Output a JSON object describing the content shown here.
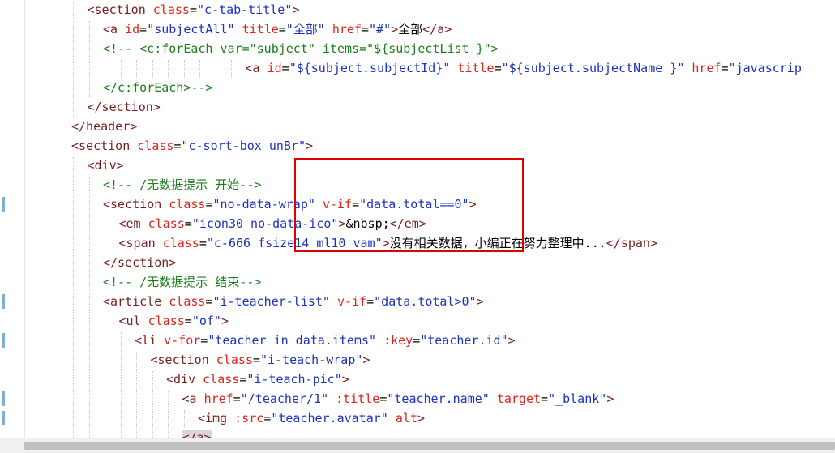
{
  "editor": {
    "lines": [
      {
        "indent": 5,
        "tokens": [
          [
            "tag",
            "<section"
          ],
          [
            "sp",
            " "
          ],
          [
            "attr",
            "class"
          ],
          [
            "eq",
            "="
          ],
          [
            "val",
            "\"c-tab-title\""
          ],
          [
            "tag",
            ">"
          ]
        ]
      },
      {
        "indent": 6,
        "tokens": [
          [
            "tag",
            "<a"
          ],
          [
            "sp",
            " "
          ],
          [
            "attr",
            "id"
          ],
          [
            "eq",
            "="
          ],
          [
            "val",
            "\"subjectAll\""
          ],
          [
            "sp",
            " "
          ],
          [
            "attr",
            "title"
          ],
          [
            "eq",
            "="
          ],
          [
            "val",
            "\"全部\""
          ],
          [
            "sp",
            " "
          ],
          [
            "attr",
            "href"
          ],
          [
            "eq",
            "="
          ],
          [
            "val",
            "\"#\""
          ],
          [
            "tag",
            ">"
          ],
          [
            "txt",
            "全部"
          ],
          [
            "tag",
            "</a>"
          ]
        ]
      },
      {
        "indent": 6,
        "tokens": [
          [
            "cmt",
            "<!-- <c:forEach var=\"subject\" items=\"${subjectList }\">"
          ]
        ]
      },
      {
        "indent": 15,
        "tokens": [
          [
            "tag",
            "<a"
          ],
          [
            "sp",
            " "
          ],
          [
            "attr",
            "id"
          ],
          [
            "eq",
            "="
          ],
          [
            "val",
            "\"${subject.subjectId}\""
          ],
          [
            "sp",
            " "
          ],
          [
            "attr",
            "title"
          ],
          [
            "eq",
            "="
          ],
          [
            "val",
            "\"${subject.subjectName }\""
          ],
          [
            "sp",
            " "
          ],
          [
            "attr",
            "href"
          ],
          [
            "eq",
            "="
          ],
          [
            "val",
            "\"javascrip"
          ]
        ]
      },
      {
        "indent": 6,
        "tokens": [
          [
            "cmt",
            "</c:forEach>-->"
          ]
        ]
      },
      {
        "indent": 5,
        "tokens": [
          [
            "tag",
            "</section>"
          ]
        ]
      },
      {
        "indent": 4,
        "tokens": [
          [
            "tag",
            "</header>"
          ]
        ]
      },
      {
        "indent": 4,
        "tokens": [
          [
            "tag",
            "<section"
          ],
          [
            "sp",
            " "
          ],
          [
            "attr",
            "class"
          ],
          [
            "eq",
            "="
          ],
          [
            "val",
            "\"c-sort-box unBr\""
          ],
          [
            "tag",
            ">"
          ]
        ]
      },
      {
        "indent": 5,
        "tokens": [
          [
            "tag",
            "<div>"
          ]
        ]
      },
      {
        "indent": 6,
        "tokens": [
          [
            "cmt",
            "<!-- /无数据提示 开始-->"
          ]
        ]
      },
      {
        "indent": 6,
        "tokens": [
          [
            "tag",
            "<section"
          ],
          [
            "sp",
            " "
          ],
          [
            "attr",
            "class"
          ],
          [
            "eq",
            "="
          ],
          [
            "val",
            "\"no-data-wrap\""
          ],
          [
            "sp",
            " "
          ],
          [
            "attr",
            "v-if"
          ],
          [
            "eq",
            "="
          ],
          [
            "val",
            "\"data.total==0\""
          ],
          [
            "tag",
            ">"
          ]
        ]
      },
      {
        "indent": 7,
        "tokens": [
          [
            "tag",
            "<em"
          ],
          [
            "sp",
            " "
          ],
          [
            "attr",
            "class"
          ],
          [
            "eq",
            "="
          ],
          [
            "val",
            "\"icon30 no-data-ico\""
          ],
          [
            "tag",
            ">"
          ],
          [
            "txt",
            "&nbsp;"
          ],
          [
            "tag",
            "</em>"
          ]
        ]
      },
      {
        "indent": 7,
        "tokens": [
          [
            "tag",
            "<span"
          ],
          [
            "sp",
            " "
          ],
          [
            "attr",
            "class"
          ],
          [
            "eq",
            "="
          ],
          [
            "val",
            "\"c-666 fsize14 ml10 vam\""
          ],
          [
            "tag",
            ">"
          ],
          [
            "txt",
            "没有相关数据，小编正在努力整理中..."
          ],
          [
            "tag",
            "</span>"
          ]
        ]
      },
      {
        "indent": 6,
        "tokens": [
          [
            "tag",
            "</section>"
          ]
        ]
      },
      {
        "indent": 6,
        "tokens": [
          [
            "cmt",
            "<!-- /无数据提示 结束-->"
          ]
        ]
      },
      {
        "indent": 6,
        "tokens": [
          [
            "tag",
            "<article"
          ],
          [
            "sp",
            " "
          ],
          [
            "attr",
            "class"
          ],
          [
            "eq",
            "="
          ],
          [
            "val",
            "\"i-teacher-list\""
          ],
          [
            "sp",
            " "
          ],
          [
            "attr",
            "v-if"
          ],
          [
            "eq",
            "="
          ],
          [
            "val",
            "\"data.total>0\""
          ],
          [
            "tag",
            ">"
          ]
        ]
      },
      {
        "indent": 7,
        "tokens": [
          [
            "tag",
            "<ul"
          ],
          [
            "sp",
            " "
          ],
          [
            "attr",
            "class"
          ],
          [
            "eq",
            "="
          ],
          [
            "val",
            "\"of\""
          ],
          [
            "tag",
            ">"
          ]
        ]
      },
      {
        "indent": 8,
        "tokens": [
          [
            "tag",
            "<li"
          ],
          [
            "sp",
            " "
          ],
          [
            "attr",
            "v-for"
          ],
          [
            "eq",
            "="
          ],
          [
            "val",
            "\"teacher in data.items\""
          ],
          [
            "sp",
            " "
          ],
          [
            "attr",
            ":key"
          ],
          [
            "eq",
            "="
          ],
          [
            "val",
            "\"teacher.id\""
          ],
          [
            "tag",
            ">"
          ]
        ]
      },
      {
        "indent": 9,
        "tokens": [
          [
            "tag",
            "<section"
          ],
          [
            "sp",
            " "
          ],
          [
            "attr",
            "class"
          ],
          [
            "eq",
            "="
          ],
          [
            "val",
            "\"i-teach-wrap\""
          ],
          [
            "tag",
            ">"
          ]
        ]
      },
      {
        "indent": 10,
        "tokens": [
          [
            "tag",
            "<div"
          ],
          [
            "sp",
            " "
          ],
          [
            "attr",
            "class"
          ],
          [
            "eq",
            "="
          ],
          [
            "val",
            "\"i-teach-pic\""
          ],
          [
            "tag",
            ">"
          ]
        ]
      },
      {
        "indent": 11,
        "tokens": [
          [
            "tag",
            "<a"
          ],
          [
            "sp",
            " "
          ],
          [
            "attr",
            "href"
          ],
          [
            "eq",
            "="
          ],
          [
            "link",
            "\"/teacher/1\""
          ],
          [
            "sp",
            " "
          ],
          [
            "attr",
            ":title"
          ],
          [
            "eq",
            "="
          ],
          [
            "val",
            "\"teacher.name\""
          ],
          [
            "sp",
            " "
          ],
          [
            "attr",
            "target"
          ],
          [
            "eq",
            "="
          ],
          [
            "val",
            "\"_blank\""
          ],
          [
            "tag",
            ">"
          ]
        ]
      },
      {
        "indent": 12,
        "tokens": [
          [
            "tag",
            "<img"
          ],
          [
            "sp",
            " "
          ],
          [
            "attr",
            ":src"
          ],
          [
            "eq",
            "="
          ],
          [
            "val",
            "\"teacher.avatar\""
          ],
          [
            "sp",
            " "
          ],
          [
            "attr",
            "alt"
          ],
          [
            "tag",
            ">"
          ]
        ]
      },
      {
        "indent": 11,
        "tokens": [
          [
            "caret",
            "</a>"
          ]
        ]
      }
    ],
    "gutter_markers": [
      10,
      15,
      17,
      20,
      21
    ],
    "colors": {
      "tag": "#7a1f1f",
      "attribute": "#e0231b",
      "value": "#1d31c2",
      "comment": "#1a7f1a",
      "highlight_box": "#e00000"
    }
  }
}
